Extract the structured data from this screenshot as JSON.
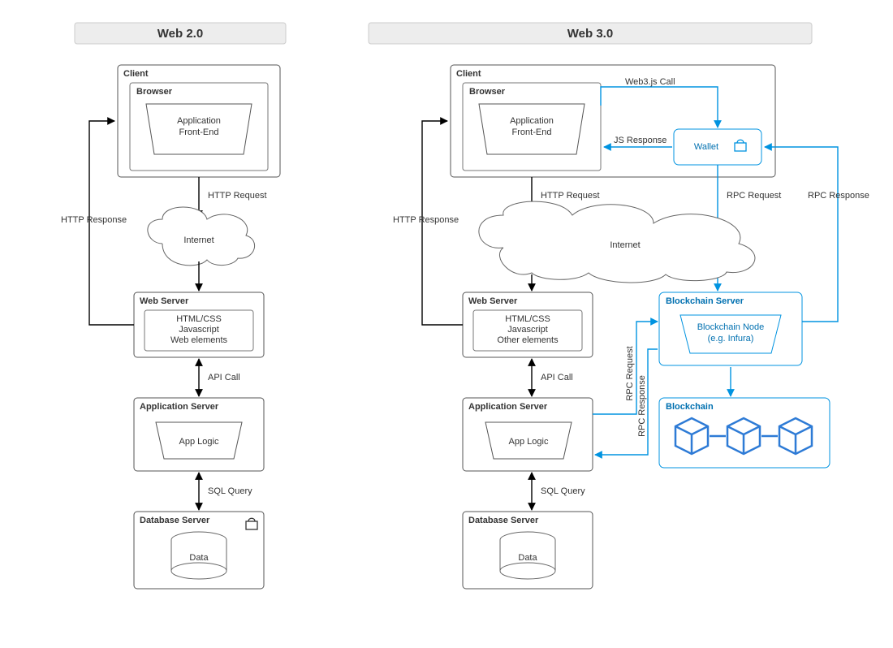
{
  "headers": {
    "web2": "Web 2.0",
    "web3": "Web 3.0"
  },
  "nodes2": {
    "client": "Client",
    "browser": "Browser",
    "app_front": [
      "Application",
      "Front-End"
    ],
    "internet": "Internet",
    "webserver": "Web Server",
    "ws_lines": [
      "HTML/CSS",
      "Javascript",
      "Web elements"
    ],
    "appserver": "Application Server",
    "applogic": "App Logic",
    "dbserver": "Database Server",
    "data": "Data"
  },
  "nodes3": {
    "client": "Client",
    "browser": "Browser",
    "app_front": [
      "Application",
      "Front-End"
    ],
    "wallet": "Wallet",
    "internet": "Internet",
    "webserver": "Web Server",
    "ws_lines": [
      "HTML/CSS",
      "Javascript",
      "Other elements"
    ],
    "appserver": "Application Server",
    "applogic": "App Logic",
    "dbserver": "Database Server",
    "data": "Data",
    "bcserver": "Blockchain Server",
    "bcnode": [
      "Blockchain Node",
      "(e.g. Infura)"
    ],
    "blockchain": "Blockchain"
  },
  "labels": {
    "http_req": "HTTP Request",
    "http_res": "HTTP Response",
    "api_call": "API Call",
    "sql": "SQL Query",
    "web3call": "Web3.js Call",
    "jsres": "JS Response",
    "rpc_req": "RPC Request",
    "rpc_res": "RPC Response"
  },
  "colors": {
    "accent": "#0093e0"
  }
}
